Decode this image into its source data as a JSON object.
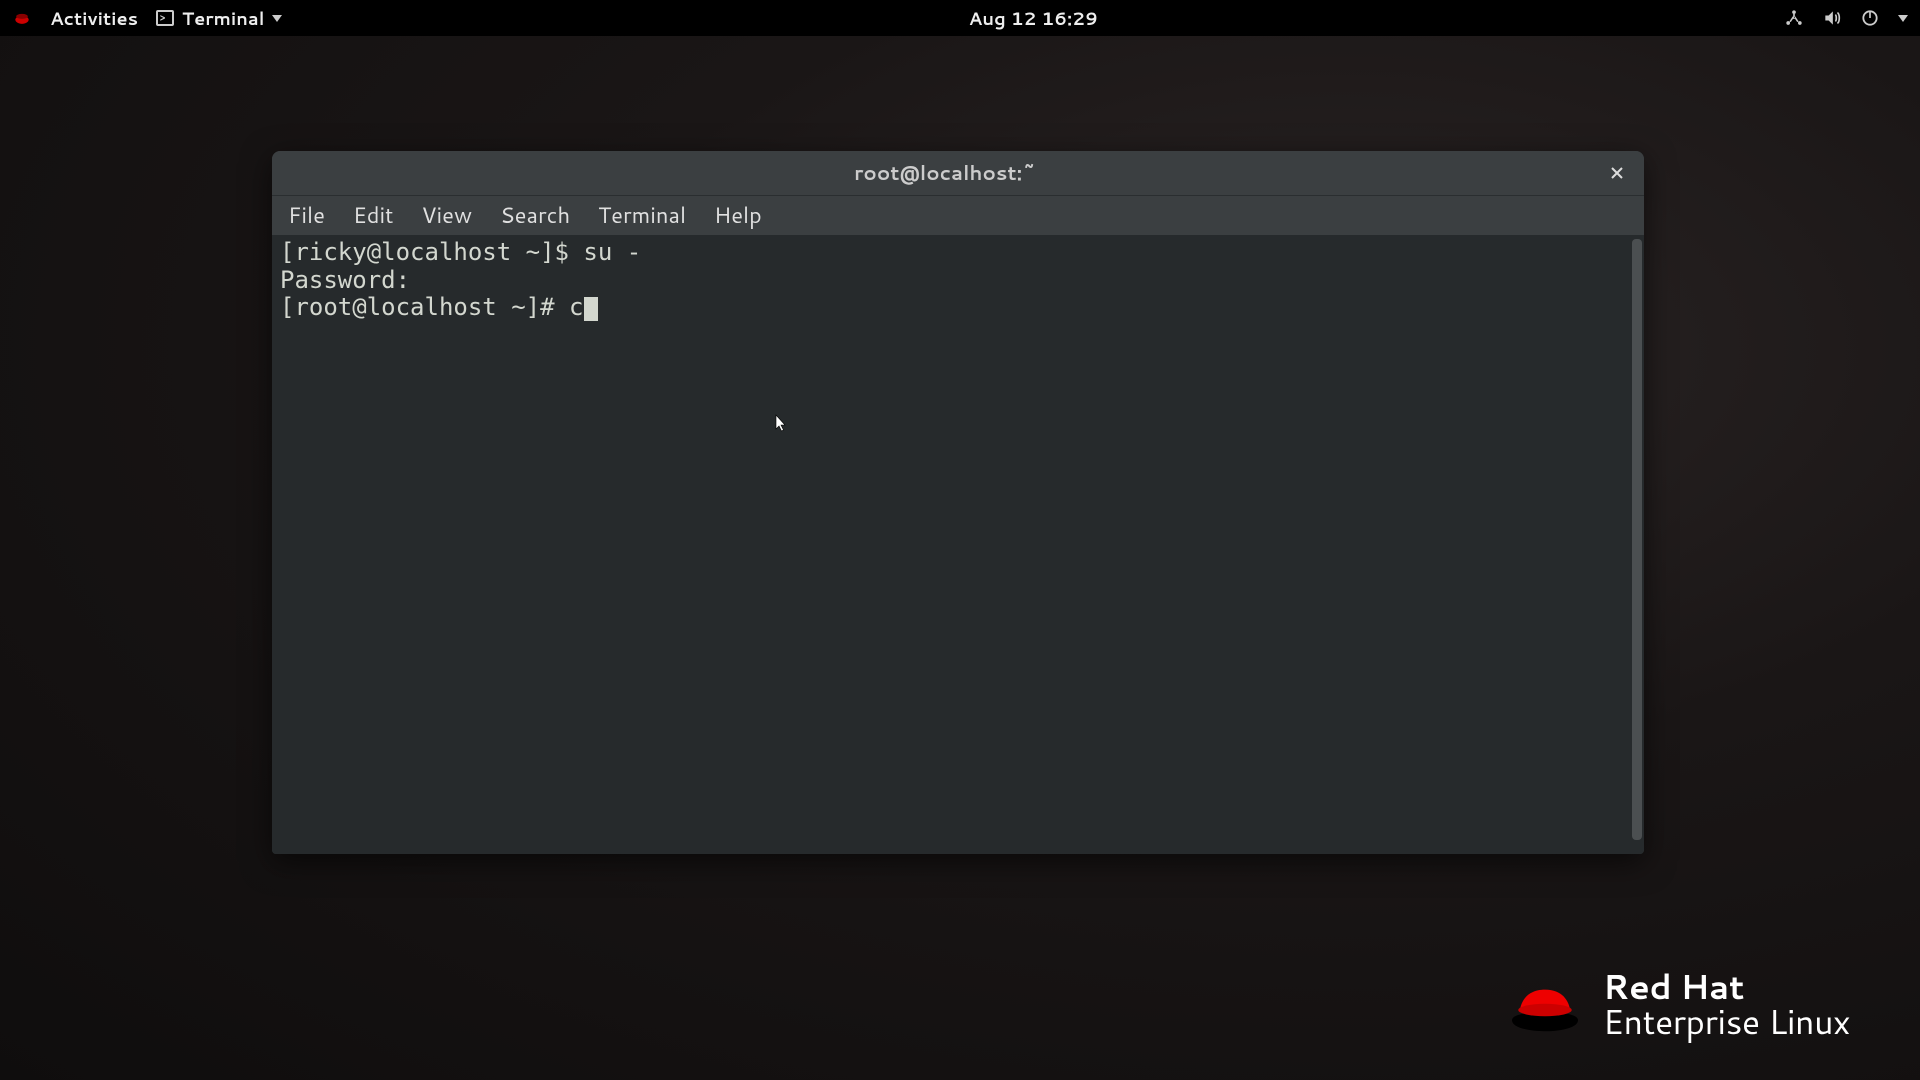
{
  "topbar": {
    "activities": "Activities",
    "app_name": "Terminal",
    "clock": "Aug 12  16:29"
  },
  "window": {
    "title": "root@localhost:~",
    "menus": [
      "File",
      "Edit",
      "View",
      "Search",
      "Terminal",
      "Help"
    ]
  },
  "terminal": {
    "lines": [
      "[ricky@localhost ~]$ su -",
      "Password:",
      "[root@localhost ~]# c"
    ],
    "typed_partial": "c"
  },
  "branding": {
    "line1": "Red Hat",
    "line2": "Enterprise Linux"
  }
}
